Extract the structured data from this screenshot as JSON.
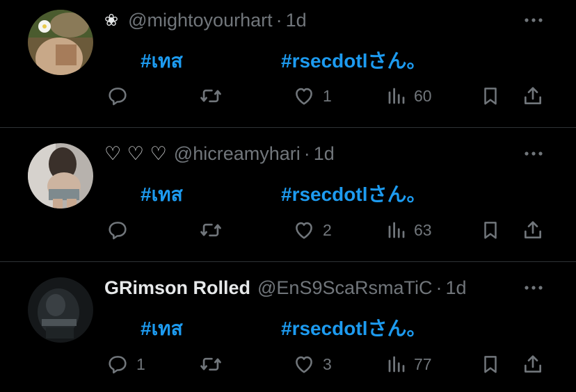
{
  "posts": [
    {
      "display_name": "",
      "name_prefix_glyph": "❀",
      "handle": "@mightoyourhart",
      "time": "1d",
      "tag1": "#เทส",
      "tag2": "#rsecdotlさん。",
      "replies": "",
      "reposts": "",
      "likes": "1",
      "views": "60"
    },
    {
      "display_name": "",
      "name_prefix_glyph": "♡ ♡ ♡",
      "handle": "@hicreamyhari",
      "time": "1d",
      "tag1": "#เทส",
      "tag2": "#rsecdotlさん。",
      "replies": "",
      "reposts": "",
      "likes": "2",
      "views": "63"
    },
    {
      "display_name": "GRimson Rolled",
      "name_prefix_glyph": "",
      "handle": "@EnS9ScaRsmaTiC",
      "time": "1d",
      "tag1": "#เทส",
      "tag2": "#rsecdotlさん。",
      "replies": "1",
      "reposts": "",
      "likes": "3",
      "views": "77"
    }
  ],
  "separator": "·",
  "colors": {
    "background": "#000000",
    "text": "#e7e9ea",
    "muted": "#71767b",
    "accent": "#1d9bf0",
    "divider": "#2f3336"
  },
  "icons": [
    "reply-icon",
    "repost-icon",
    "like-icon",
    "views-icon",
    "bookmark-icon",
    "share-icon",
    "more-icon"
  ]
}
